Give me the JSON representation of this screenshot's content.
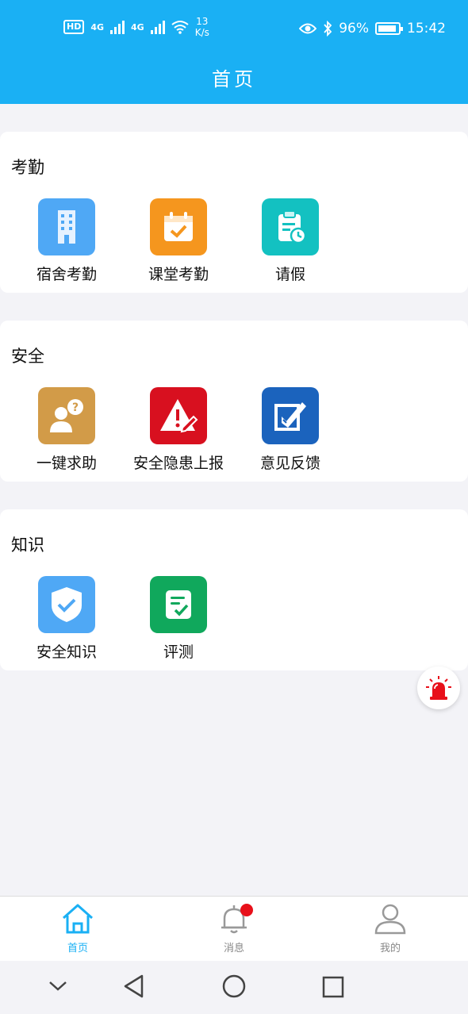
{
  "status_bar": {
    "network_label": "HD",
    "signal1": "4G",
    "signal2": "4G",
    "speed_value": "13",
    "speed_unit": "K/s",
    "battery": "96%",
    "time": "15:42"
  },
  "header": {
    "title": "首页"
  },
  "sections": [
    {
      "title": "考勤",
      "items": [
        {
          "label": "宿舍考勤",
          "icon": "building-icon",
          "color": "#4fa8f5"
        },
        {
          "label": "课堂考勤",
          "icon": "calendar-check-icon",
          "color": "#f5961e"
        },
        {
          "label": "请假",
          "icon": "clipboard-clock-icon",
          "color": "#13c1c1"
        }
      ]
    },
    {
      "title": "安全",
      "items": [
        {
          "label": "一键求助",
          "icon": "person-question-icon",
          "color": "#d29b48"
        },
        {
          "label": "安全隐患上报",
          "icon": "warning-edit-icon",
          "color": "#d8101f"
        },
        {
          "label": "意见反馈",
          "icon": "edit-feedback-icon",
          "color": "#1b63bd"
        }
      ]
    },
    {
      "title": "知识",
      "items": [
        {
          "label": "安全知识",
          "icon": "shield-check-icon",
          "color": "#4fa8f5"
        },
        {
          "label": "评测",
          "icon": "checklist-icon",
          "color": "#10a85c"
        }
      ]
    }
  ],
  "alarm_button": {
    "icon": "alarm-siren-icon",
    "color": "#e8101a"
  },
  "tabbar": {
    "tabs": [
      {
        "label": "首页",
        "icon": "home-icon",
        "active": true
      },
      {
        "label": "消息",
        "icon": "bell-icon",
        "active": false,
        "has_badge": true
      },
      {
        "label": "我的",
        "icon": "user-icon",
        "active": false
      }
    ],
    "active_color": "#1ab0f4",
    "inactive_color": "#999999"
  },
  "system_nav": [
    "chevron-down-icon",
    "back-icon",
    "home-circle-icon",
    "recents-icon"
  ]
}
